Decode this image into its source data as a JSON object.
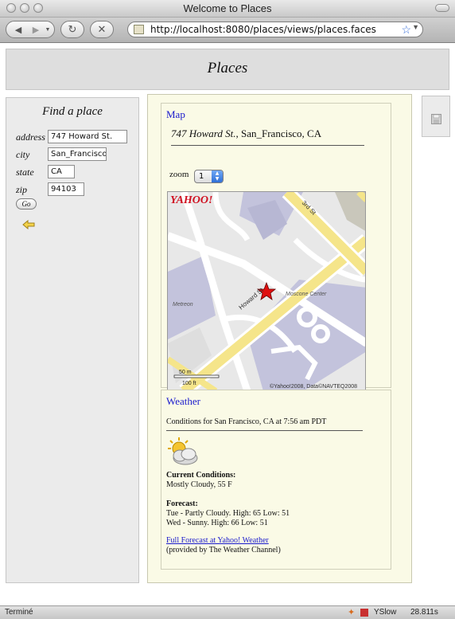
{
  "window": {
    "title": "Welcome to Places"
  },
  "toolbar": {
    "url": "http://localhost:8080/places/views/places.faces"
  },
  "page": {
    "title": "Places"
  },
  "find": {
    "heading": "Find a place",
    "address_label": "address",
    "address_value": "747 Howard St.",
    "city_label": "city",
    "city_value": "San_Francisco",
    "state_label": "state",
    "state_value": "CA",
    "zip_label": "zip",
    "zip_value": "94103",
    "go_label": "Go"
  },
  "map": {
    "title": "Map",
    "street": "747 Howard St.",
    "city_state": ", San_Francisco, CA",
    "zoom_label": "zoom",
    "zoom_value": "1",
    "brand": "YAHOO!",
    "street_3rd": "3rd St",
    "street_howard": "Howard St",
    "place_metreon": "Metreon",
    "place_moscone": "Moscone Center",
    "scale_m": "50 m",
    "scale_ft": "100 ft",
    "copyright": "©Yahoo!2008, Data©NAVTEQ2008"
  },
  "weather": {
    "title": "Weather",
    "conditions_for": "Conditions for San Francisco, CA at 7:56 am PDT",
    "current_label": "Current Conditions:",
    "current_value": "Mostly Cloudy, 55 F",
    "forecast_label": "Forecast:",
    "forecast_1": "Tue - Partly Cloudy. High: 65 Low: 51",
    "forecast_2": "Wed - Sunny. High: 66 Low: 51",
    "full_forecast_link": "Full Forecast at Yahoo! Weather",
    "provider": "(provided by The Weather Channel)"
  },
  "status": {
    "left": "Terminé",
    "yslow": "YSlow",
    "time": "28.811s"
  },
  "colors": {
    "link": "#1a1acc",
    "panel_bg": "#fafae6",
    "map_road": "#f5e58a"
  }
}
